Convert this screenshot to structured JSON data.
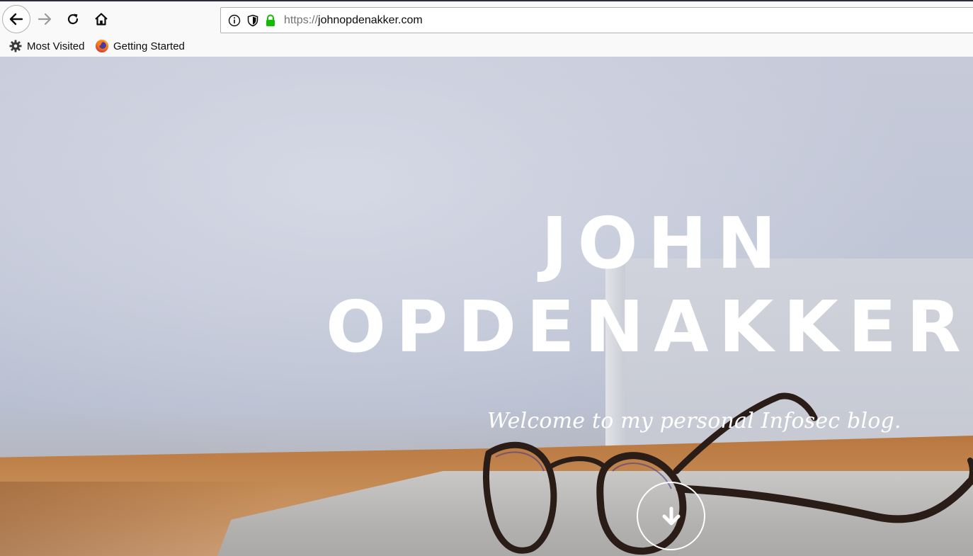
{
  "browser": {
    "nav": {
      "back_icon": "arrow-left-icon",
      "forward_icon": "arrow-right-icon",
      "reload_icon": "reload-icon",
      "home_icon": "home-icon"
    },
    "urlbar": {
      "scheme": "https://",
      "host": "johnopdenakker.com",
      "icons": [
        "info-icon",
        "shield-icon",
        "lock-icon"
      ]
    },
    "bookmarks": [
      {
        "label": "Most Visited",
        "icon": "gear-icon"
      },
      {
        "label": "Getting Started",
        "icon": "firefox-logo-icon"
      }
    ],
    "colors": {
      "lock": "#12bc00"
    }
  },
  "hero": {
    "title_line1": "JOHN",
    "title_line2": "OPDENAKKER",
    "subtitle": "Welcome to my personal Infosec blog.",
    "scroll_icon": "arrow-down-icon"
  }
}
